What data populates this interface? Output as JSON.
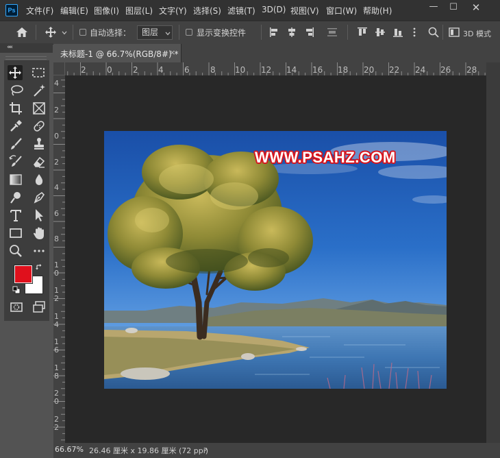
{
  "menubar": {
    "logo_text": "Ps",
    "items": [
      "文件(F)",
      "编辑(E)",
      "图像(I)",
      "图层(L)",
      "文字(Y)",
      "选择(S)",
      "滤镜(T)",
      "3D(D)",
      "视图(V)",
      "窗口(W)",
      "帮助(H)"
    ],
    "window_buttons": [
      "—",
      "☐",
      "✕"
    ]
  },
  "options": {
    "auto_select_label": "自动选择：",
    "auto_select_target": "图层",
    "show_transform_label": "显示变换控件",
    "mode_3d_label": "3D 模式"
  },
  "panel": {
    "collapse_glyph": "««"
  },
  "document": {
    "tab_title": "未标题-1 @ 66.7%(RGB/8#) *",
    "close_glyph": "×",
    "watermark_text": "WWW.PSAHZ.COM"
  },
  "rulers": {
    "top_labels": [
      "2",
      "0",
      "2",
      "4",
      "6",
      "8",
      "10",
      "12",
      "14",
      "16",
      "18",
      "20",
      "22",
      "24",
      "26",
      "28"
    ],
    "left_labels": [
      [
        "4"
      ],
      [
        "2"
      ],
      [
        "0"
      ],
      [
        "2"
      ],
      [
        "4"
      ],
      [
        "6"
      ],
      [
        "8"
      ],
      [
        "1",
        "0"
      ],
      [
        "1",
        "2"
      ],
      [
        "1",
        "4"
      ],
      [
        "1",
        "6"
      ],
      [
        "1",
        "8"
      ],
      [
        "2",
        "0"
      ],
      [
        "2",
        "2"
      ]
    ]
  },
  "colors": {
    "foreground": "#e0101c",
    "background": "#ffffff",
    "watermark_outline": "#d8151d"
  },
  "status": {
    "zoom": "66.67%",
    "doc_info": "26.46 厘米 x 19.86 厘米 (72 ppi)",
    "arrow": "›"
  }
}
